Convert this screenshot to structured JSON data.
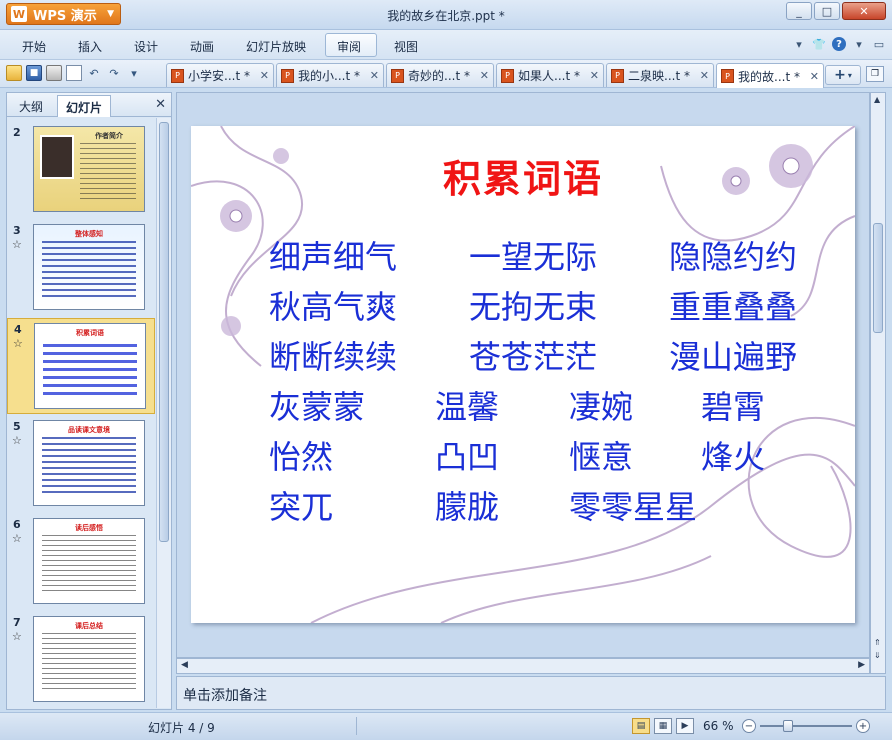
{
  "app": {
    "badge_label": "WPS 演示",
    "window_title": "我的故乡在北京.ppt *"
  },
  "menu": [
    {
      "label": "开始"
    },
    {
      "label": "插入"
    },
    {
      "label": "设计"
    },
    {
      "label": "动画"
    },
    {
      "label": "幻灯片放映"
    },
    {
      "label": "审阅"
    },
    {
      "label": "视图"
    }
  ],
  "tabs": [
    {
      "label": "小学安...t *"
    },
    {
      "label": "我的小...t *"
    },
    {
      "label": "奇妙的...t *"
    },
    {
      "label": "如果人...t *"
    },
    {
      "label": "二泉映...t *"
    },
    {
      "label": "我的故...t *",
      "active": true
    }
  ],
  "panel": {
    "tab_outline": "大纲",
    "tab_slides": "幻灯片"
  },
  "thumbnails": [
    {
      "num": "2",
      "title": "作者简介"
    },
    {
      "num": "3",
      "title": "整体感知"
    },
    {
      "num": "4",
      "title": "积累词语",
      "selected": true
    },
    {
      "num": "5",
      "title": "品读课文意境"
    },
    {
      "num": "6",
      "title": "读后感悟"
    },
    {
      "num": "7",
      "title": "课后总结"
    }
  ],
  "slide": {
    "title": "积累词语",
    "rows": [
      [
        "细声细气",
        "一望无际",
        "隐隐约约"
      ],
      [
        "秋高气爽",
        "无拘无束",
        "重重叠叠"
      ],
      [
        "断断续续",
        "苍苍茫茫",
        "漫山遍野"
      ],
      [
        "灰蒙蒙",
        "温馨",
        "凄婉",
        "碧霄"
      ],
      [
        "怡然",
        "凸凹",
        "惬意",
        "烽火"
      ],
      [
        "突兀",
        "朦胧",
        "零零星星"
      ]
    ],
    "title_color": "#f01414",
    "word_color": "#1a2fd6"
  },
  "notes_placeholder": "单击添加备注",
  "status": {
    "slide_counter": "幻灯片 4 / 9",
    "zoom": "66 %"
  }
}
